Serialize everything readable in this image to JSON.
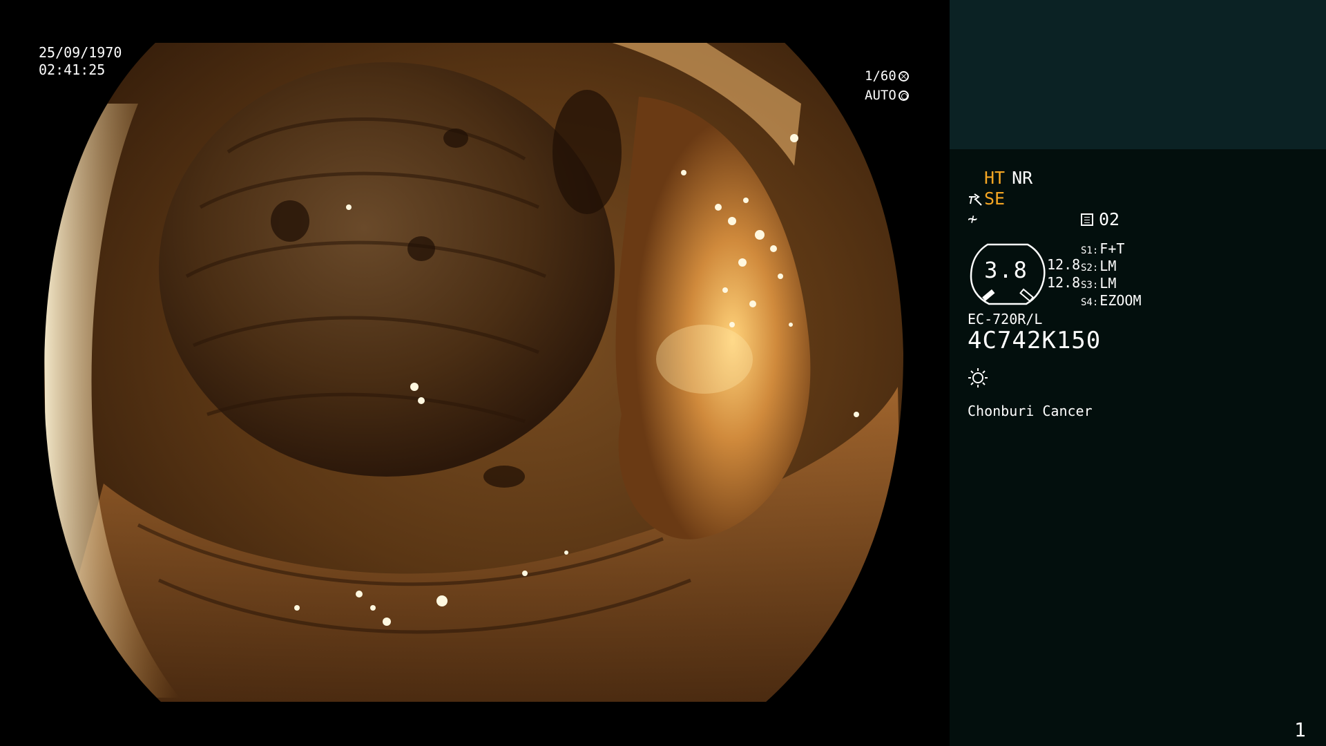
{
  "image": {
    "timestamp_date": "25/09/1970",
    "timestamp_time": "02:41:25",
    "shutter_speed": "1/60",
    "shutter_mode": "AUTO",
    "icons": {
      "shutter_speed_icon": "aperture-icon",
      "shutter_mode_icon": "iris-ring-icon"
    }
  },
  "panel": {
    "enhancement": {
      "ht": "HT",
      "nr": "NR"
    },
    "structure": {
      "se": "SE"
    },
    "freeze_symbol": "≁",
    "page": {
      "number": "02"
    },
    "gauge": {
      "value": "3.8",
      "top_number": "12.8",
      "bottom_number": "12.8"
    },
    "switches": [
      {
        "key": "S1:",
        "value": "F+T"
      },
      {
        "key": "S2:",
        "value": "LM"
      },
      {
        "key": "S3:",
        "value": "LM"
      },
      {
        "key": "S4:",
        "value": "EZOOM"
      }
    ],
    "scope_model": "EC-720R/L",
    "scope_serial": "4C742K150",
    "light_icon": "light-source-icon",
    "institution": "Chonburi Cancer",
    "frame_number": "1"
  },
  "colors": {
    "panel_bg": "#030f0d",
    "panel_header": "#0b2224",
    "accent": "#f5a623",
    "text": "#ffffff"
  }
}
